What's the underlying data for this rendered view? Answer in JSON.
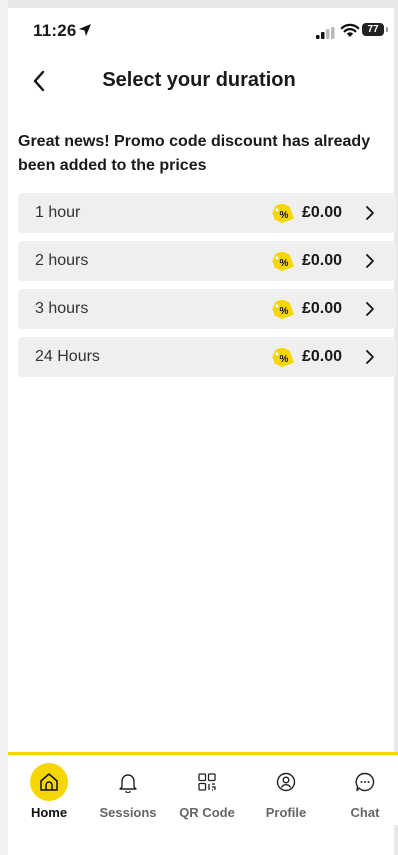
{
  "status_bar": {
    "time": "11:26",
    "battery": "77"
  },
  "header": {
    "title": "Select your duration"
  },
  "promo_text": "Great news! Promo code discount has already been added to the prices",
  "tag_symbol": "%",
  "options": [
    {
      "label": "1 hour",
      "price": "£0.00"
    },
    {
      "label": "2 hours",
      "price": "£0.00"
    },
    {
      "label": "3 hours",
      "price": "£0.00"
    },
    {
      "label": "24 Hours",
      "price": "£0.00"
    }
  ],
  "tabs": [
    {
      "label": "Home",
      "icon": "home-icon",
      "active": true
    },
    {
      "label": "Sessions",
      "icon": "bell-icon",
      "active": false
    },
    {
      "label": "QR Code",
      "icon": "qr-code-icon",
      "active": false
    },
    {
      "label": "Profile",
      "icon": "profile-icon",
      "active": false
    },
    {
      "label": "Chat",
      "icon": "chat-icon",
      "active": false
    }
  ],
  "colors": {
    "accent": "#f5d600",
    "row_background": "#efefef",
    "tag": "#f5d600"
  }
}
